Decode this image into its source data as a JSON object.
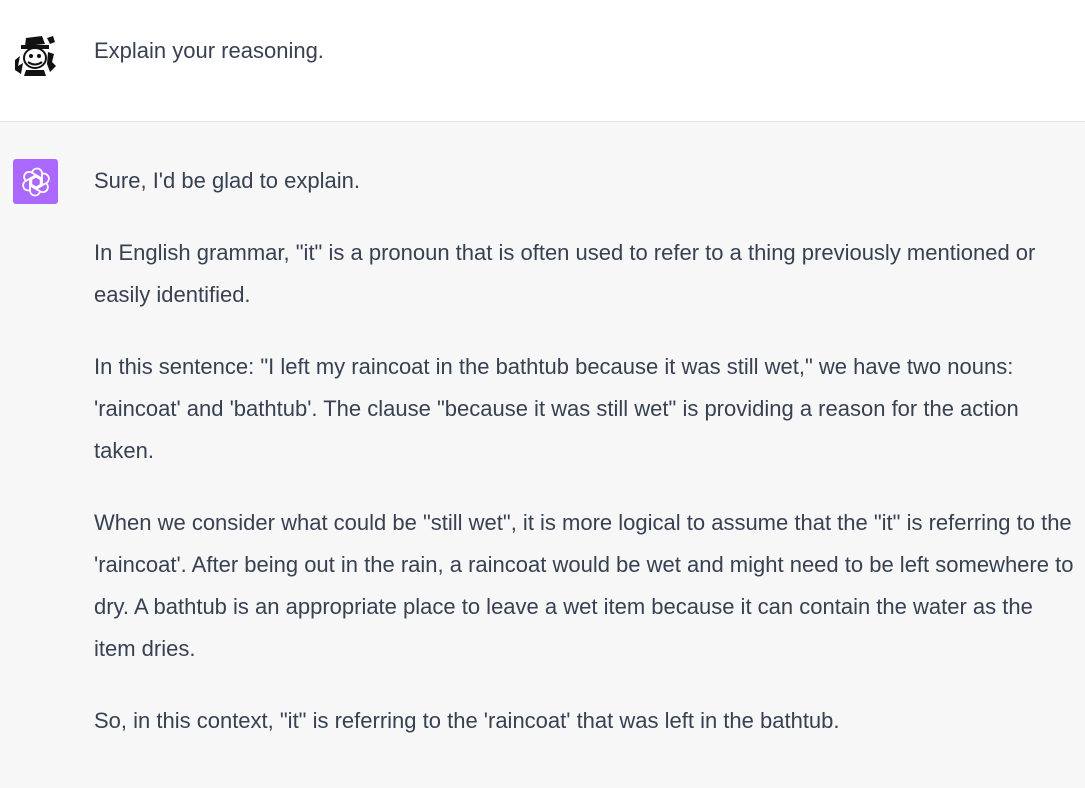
{
  "user_message": {
    "text": "Explain your reasoning."
  },
  "assistant_message": {
    "paragraphs": [
      "Sure, I'd be glad to explain.",
      "In English grammar, \"it\" is a pronoun that is often used to refer to a thing previously mentioned or easily identified.",
      "In this sentence: \"I left my raincoat in the bathtub because it was still wet,\" we have two nouns: 'raincoat' and 'bathtub'. The clause \"because it was still wet\" is providing a reason for the action taken.",
      "When we consider what could be \"still wet\", it is more logical to assume that the \"it\" is referring to the 'raincoat'. After being out in the rain, a raincoat would be wet and might need to be left somewhere to dry. A bathtub is an appropriate place to leave a wet item because it can contain the water as the item dries.",
      "So, in this context, \"it\" is referring to the 'raincoat' that was left in the bathtub."
    ]
  },
  "colors": {
    "assistant_avatar_bg": "#ab68ff",
    "assistant_row_bg": "#f7f7f8",
    "text": "#374151"
  },
  "icons": {
    "user_avatar": "user-avatar-icon",
    "assistant_avatar": "openai-logo-icon"
  }
}
